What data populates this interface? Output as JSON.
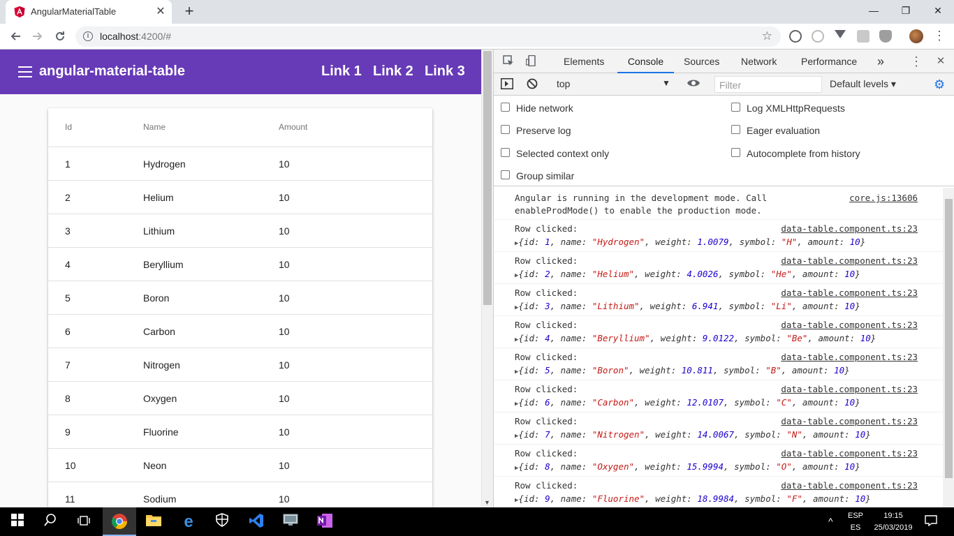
{
  "browser": {
    "tab_title": "AngularMaterialTable",
    "tab_close": "✕",
    "new_tab": "+",
    "url_host": "localhost",
    "url_path": ":4200/#",
    "window_minimize": "—",
    "window_restore": "❐",
    "window_close": "✕"
  },
  "app": {
    "title": "angular-material-table",
    "links": [
      "Link 1",
      "Link 2",
      "Link 3"
    ]
  },
  "table": {
    "headers": [
      "Id",
      "Name",
      "Amount"
    ],
    "rows": [
      {
        "id": "1",
        "name": "Hydrogen",
        "amount": "10"
      },
      {
        "id": "2",
        "name": "Helium",
        "amount": "10"
      },
      {
        "id": "3",
        "name": "Lithium",
        "amount": "10"
      },
      {
        "id": "4",
        "name": "Beryllium",
        "amount": "10"
      },
      {
        "id": "5",
        "name": "Boron",
        "amount": "10"
      },
      {
        "id": "6",
        "name": "Carbon",
        "amount": "10"
      },
      {
        "id": "7",
        "name": "Nitrogen",
        "amount": "10"
      },
      {
        "id": "8",
        "name": "Oxygen",
        "amount": "10"
      },
      {
        "id": "9",
        "name": "Fluorine",
        "amount": "10"
      },
      {
        "id": "10",
        "name": "Neon",
        "amount": "10"
      },
      {
        "id": "11",
        "name": "Sodium",
        "amount": "10"
      }
    ]
  },
  "devtools": {
    "tabs": [
      "Elements",
      "Console",
      "Sources",
      "Network",
      "Performance"
    ],
    "active_tab": "Console",
    "more_tabs": "»",
    "context": "top",
    "filter_placeholder": "Filter",
    "levels": "Default levels ▾",
    "options_left": [
      "Hide network",
      "Preserve log",
      "Selected context only",
      "Group similar"
    ],
    "options_right": [
      "Log XMLHttpRequests",
      "Eager evaluation",
      "Autocomplete from history"
    ],
    "first_message": {
      "line1": "Angular is running in the development mode. Call",
      "line2": "enableProdMode() to enable the production mode.",
      "source": "core.js:13606"
    },
    "row_clicked_label": "Row clicked:",
    "row_source": "data-table.component.ts:23",
    "logs": [
      {
        "id": "1",
        "name": "\"Hydrogen\"",
        "weight": "1.0079",
        "symbol": "\"H\"",
        "amount": "10"
      },
      {
        "id": "2",
        "name": "\"Helium\"",
        "weight": "4.0026",
        "symbol": "\"He\"",
        "amount": "10"
      },
      {
        "id": "3",
        "name": "\"Lithium\"",
        "weight": "6.941",
        "symbol": "\"Li\"",
        "amount": "10"
      },
      {
        "id": "4",
        "name": "\"Beryllium\"",
        "weight": "9.0122",
        "symbol": "\"Be\"",
        "amount": "10"
      },
      {
        "id": "5",
        "name": "\"Boron\"",
        "weight": "10.811",
        "symbol": "\"B\"",
        "amount": "10"
      },
      {
        "id": "6",
        "name": "\"Carbon\"",
        "weight": "12.0107",
        "symbol": "\"C\"",
        "amount": "10"
      },
      {
        "id": "7",
        "name": "\"Nitrogen\"",
        "weight": "14.0067",
        "symbol": "\"N\"",
        "amount": "10"
      },
      {
        "id": "8",
        "name": "\"Oxygen\"",
        "weight": "15.9994",
        "symbol": "\"O\"",
        "amount": "10"
      },
      {
        "id": "9",
        "name": "\"Fluorine\"",
        "weight": "18.9984",
        "symbol": "\"F\"",
        "amount": "10"
      }
    ]
  },
  "taskbar": {
    "lang_top": "ESP",
    "lang_bottom": "ES",
    "time": "19:15",
    "date": "25/03/2019"
  },
  "colors": {
    "appbar": "#673ab7",
    "console_string": "#c41a16",
    "console_number": "#1c00cf",
    "devtools_accent": "#1a73e8"
  }
}
